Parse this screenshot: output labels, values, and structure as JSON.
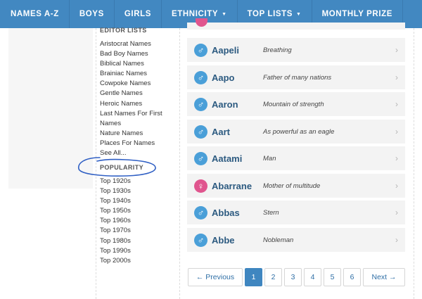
{
  "nav": {
    "items": [
      {
        "label": "NAMES A-Z"
      },
      {
        "label": "BOYS"
      },
      {
        "label": "GIRLS"
      },
      {
        "label": "ETHNICITY"
      },
      {
        "label": "TOP LISTS"
      },
      {
        "label": "MONTHLY PRIZE"
      }
    ]
  },
  "sidebar": {
    "editor_heading": "EDITOR LISTS",
    "editor_lists": [
      "Aristocrat Names",
      "Bad Boy Names",
      "Biblical Names",
      "Brainiac Names",
      "Cowpoke Names",
      "Gentle Names",
      "Heroic Names",
      "Last Names For First Names",
      "Nature Names",
      "Places For Names",
      "See All..."
    ],
    "popularity_heading": "POPULARITY",
    "popularity_lists": [
      "Top 1920s",
      "Top 1930s",
      "Top 1940s",
      "Top 1950s",
      "Top 1960s",
      "Top 1970s",
      "Top 1980s",
      "Top 1990s",
      "Top 2000s"
    ]
  },
  "names": [
    {
      "name": "Aapeli",
      "meaning": "Breathing",
      "gender": "male"
    },
    {
      "name": "Aapo",
      "meaning": "Father of many nations",
      "gender": "male"
    },
    {
      "name": "Aaron",
      "meaning": "Mountain of strength",
      "gender": "male"
    },
    {
      "name": "Aart",
      "meaning": "As powerful as an eagle",
      "gender": "male"
    },
    {
      "name": "Aatami",
      "meaning": "Man",
      "gender": "male"
    },
    {
      "name": "Abarrane",
      "meaning": "Mother of multitude",
      "gender": "female"
    },
    {
      "name": "Abbas",
      "meaning": "Stern",
      "gender": "male"
    },
    {
      "name": "Abbe",
      "meaning": "Nobleman",
      "gender": "male"
    }
  ],
  "icons": {
    "male": "male-symbol-icon",
    "female": "female-symbol-icon",
    "row_chevron": "chevron-right-icon",
    "nav_dropdown": "caret-down-icon"
  },
  "colors": {
    "nav_bg": "#4288c1",
    "male": "#4a9fd8",
    "female": "#e0558e",
    "active_page": "#3f86c0",
    "annotation": "#2f5fc4"
  },
  "pagination": {
    "prev": "← Previous",
    "pages": [
      "1",
      "2",
      "3",
      "4",
      "5",
      "6"
    ],
    "current": "1",
    "next": "Next →"
  }
}
